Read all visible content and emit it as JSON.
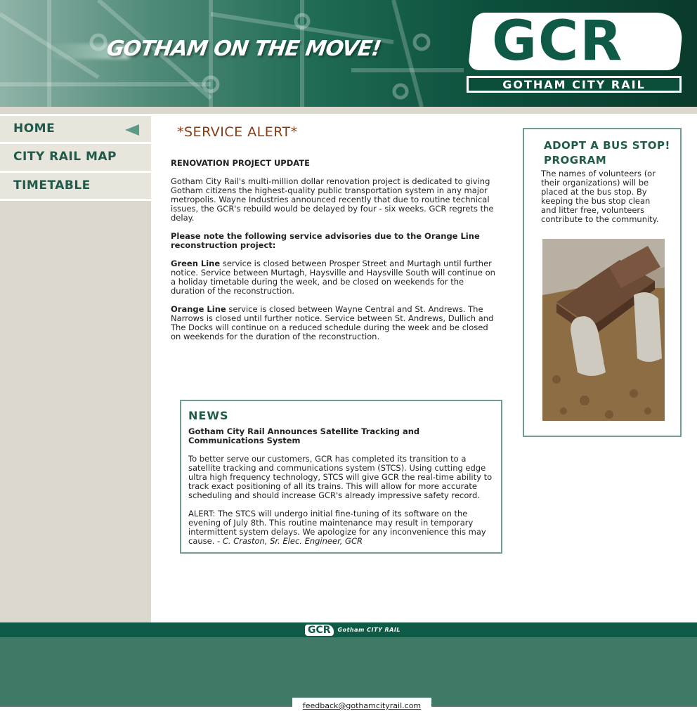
{
  "header": {
    "slogan": "GOTHAM ON THE MOVE!",
    "logo_text": "GCR",
    "logo_subtitle": "GOTHAM CITY RAIL"
  },
  "nav": {
    "items": [
      {
        "label": "HOME",
        "active": true
      },
      {
        "label": "CITY RAIL MAP",
        "active": false
      },
      {
        "label": "TIMETABLE",
        "active": false
      }
    ]
  },
  "main": {
    "alert_title": "*SERVICE ALERT*",
    "update_heading": "RENOVATION PROJECT UPDATE",
    "update_text": "Gotham City Rail's multi-million dollar renovation project is dedicated to giving Gotham citizens the highest-quality public transportation system in any major metropolis. Wayne Industries announced recently that due to routine technical issues, the GCR's rebuild would be delayed by four - six weeks. GCR regrets the delay.",
    "advisory_heading": "Please note the following service advisories due to the Orange Line reconstruction project:",
    "green_line_name": "Green Line",
    "green_line_text": " service is closed between Prosper Street and Murtagh until further notice. Service between Murtagh, Haysville and Haysville South will continue on a holiday timetable during the week, and be closed on weekends for the duration of the reconstruction.",
    "orange_line_name": "Orange Line",
    "orange_line_text": " service is closed between Wayne Central and St. Andrews. The Narrows is closed until further notice. Service between St. Andrews, Dullich and The Docks will continue on a reduced schedule during the week and be closed on weekends for the duration of the reconstruction."
  },
  "news": {
    "title": "NEWS",
    "headline": "Gotham City Rail Announces Satellite Tracking and Communications System",
    "paragraph1": "To better serve our customers, GCR has completed its transition to a satellite tracking and communications system (STCS). Using cutting edge ultra high frequency technology, STCS will give GCR the real-time ability to track exact positioning of all its trains. This will allow for more accurate scheduling and should increase GCR's already impressive safety record.",
    "paragraph2": "ALERT: The STCS will undergo initial fine-tuning of its software on the evening of July 8th. This routine maintenance may result in temporary intermittent system delays. We apologize for any inconvenience this may cause. - ",
    "signature": "C. Craston, Sr. Elec. Engineer, GCR"
  },
  "adopt": {
    "title_line1": "ADOPT A BUS STOP!",
    "title_line2": "PROGRAM",
    "text": "The names of volunteers (or their organizations) will be placed at the bus stop. By keeping the bus stop clean and litter free, volunteers contribute to the community."
  },
  "footer": {
    "logo_text": "GCR",
    "logo_subtitle": "Gotham CITY RAIL",
    "feedback_email": "feedback@gothamcityrail.com"
  },
  "colors": {
    "brand_green": "#0e5a46",
    "alert_brown": "#8b3a0e",
    "sidebar_beige": "#dcd8cd",
    "footer_green": "#3f7a66"
  }
}
